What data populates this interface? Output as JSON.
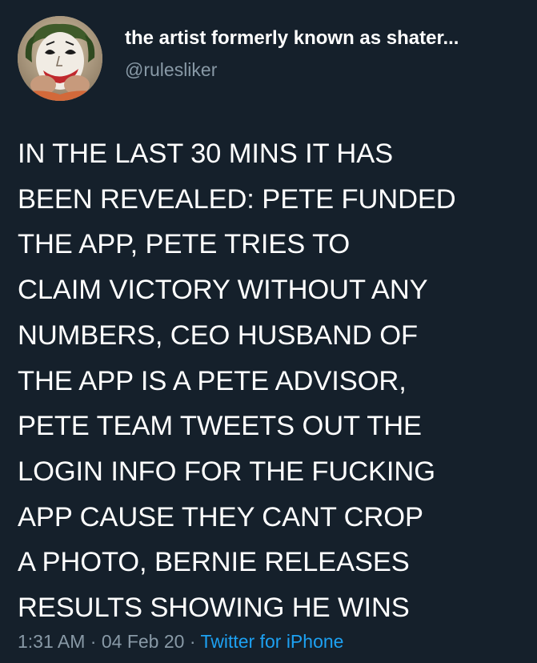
{
  "tweet": {
    "display_name": "the artist formerly known as shater...",
    "handle": "@rulesliker",
    "text": "IN THE LAST 30 MINS IT HAS\nBEEN REVEALED: PETE FUNDED\nTHE APP, PETE TRIES TO\nCLAIM VICTORY WITHOUT ANY\nNUMBERS, CEO HUSBAND OF\nTHE APP IS A PETE ADVISOR,\nPETE TEAM TWEETS OUT THE\nLOGIN INFO FOR THE FUCKING\nAPP CAUSE THEY CANT CROP\nA PHOTO, BERNIE RELEASES\nRESULTS SHOWING HE WINS",
    "time": "1:31 AM",
    "separator": " · ",
    "date": "04 Feb 20",
    "source": "Twitter for iPhone"
  },
  "colors": {
    "background": "#15202b",
    "text": "#ffffff",
    "secondary": "#8899a6",
    "link": "#1da1f2"
  }
}
